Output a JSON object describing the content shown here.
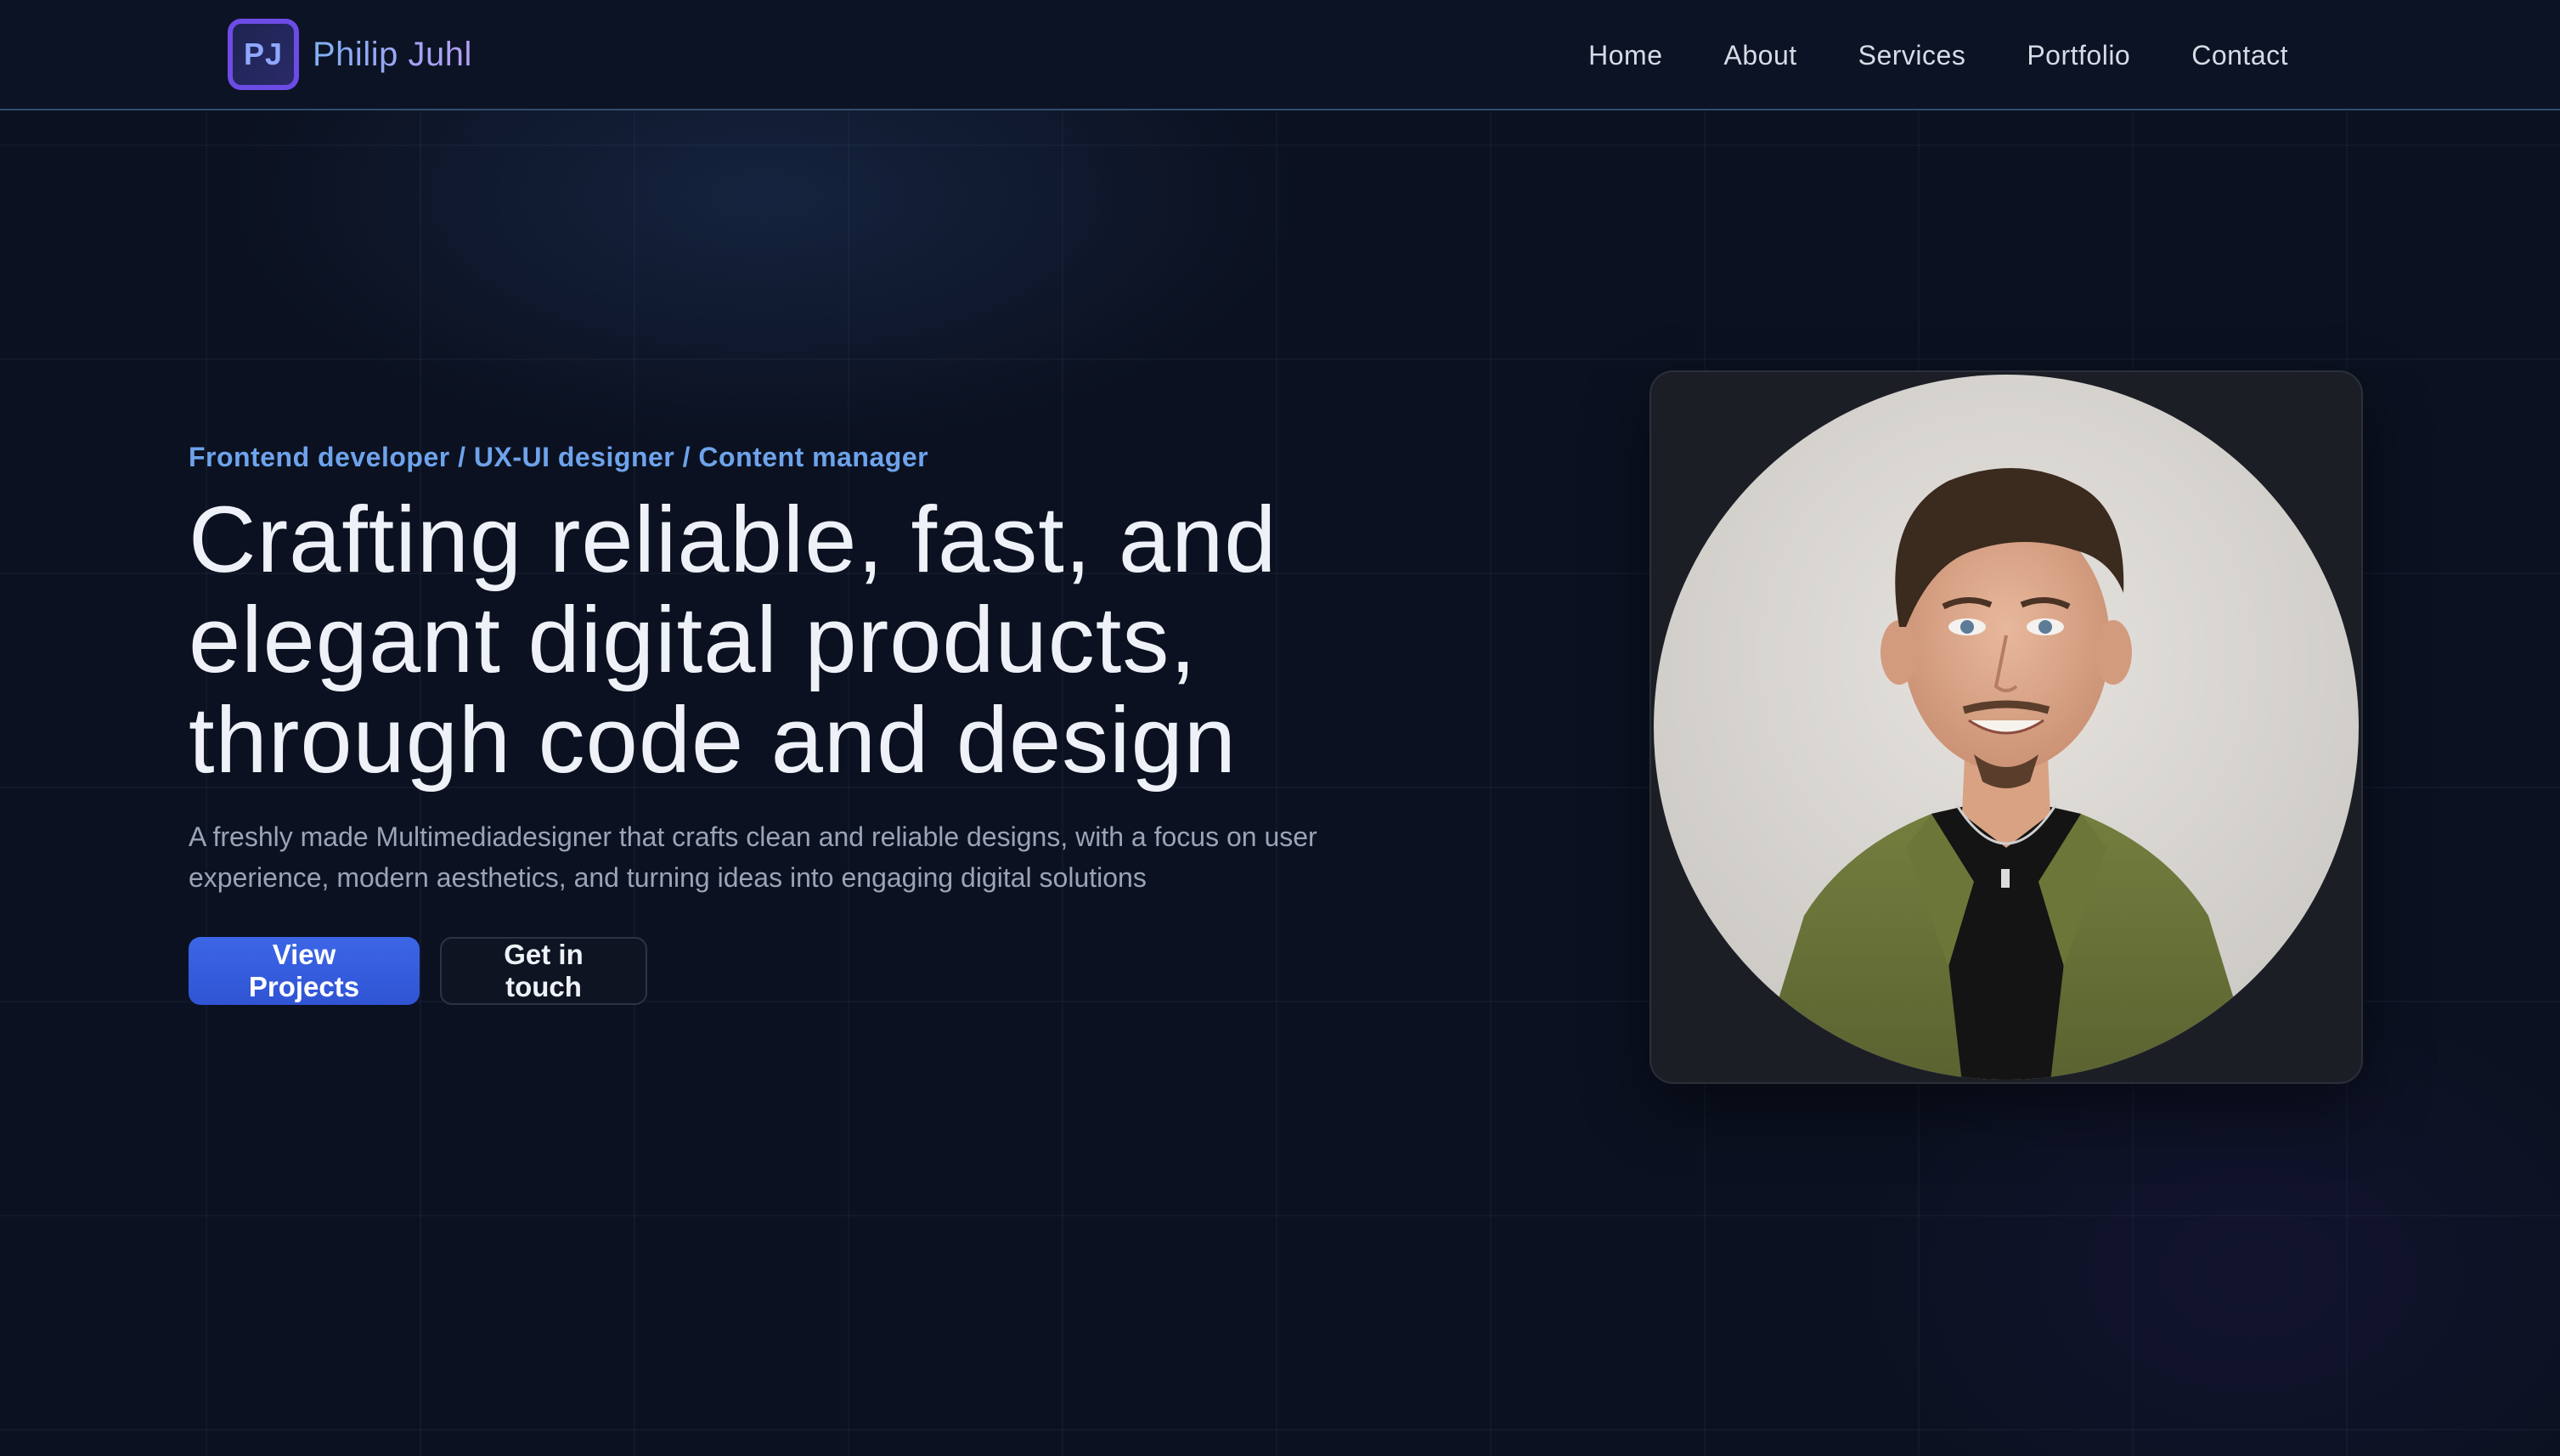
{
  "brand": {
    "initials": "PJ",
    "name": "Philip Juhl"
  },
  "nav": {
    "items": [
      {
        "label": "Home"
      },
      {
        "label": "About"
      },
      {
        "label": "Services"
      },
      {
        "label": "Portfolio"
      },
      {
        "label": "Contact"
      }
    ]
  },
  "hero": {
    "tagline": "Frontend developer / UX-UI designer / Content manager",
    "headline_lines": [
      "Crafting reliable, fast, and",
      "elegant digital products,",
      "through code and design"
    ],
    "description": "A freshly made Multimediadesigner that crafts clean and reliable designs, with a focus on user experience, modern aesthetics, and turning ideas into engaging digital solutions",
    "primary_button": "View Projects",
    "secondary_button": "Get in touch"
  },
  "colors": {
    "background": "#0b1120",
    "accent": "#3c66e6",
    "tagline": "#6ea3ec",
    "logo_border": "#6d4ce6"
  }
}
